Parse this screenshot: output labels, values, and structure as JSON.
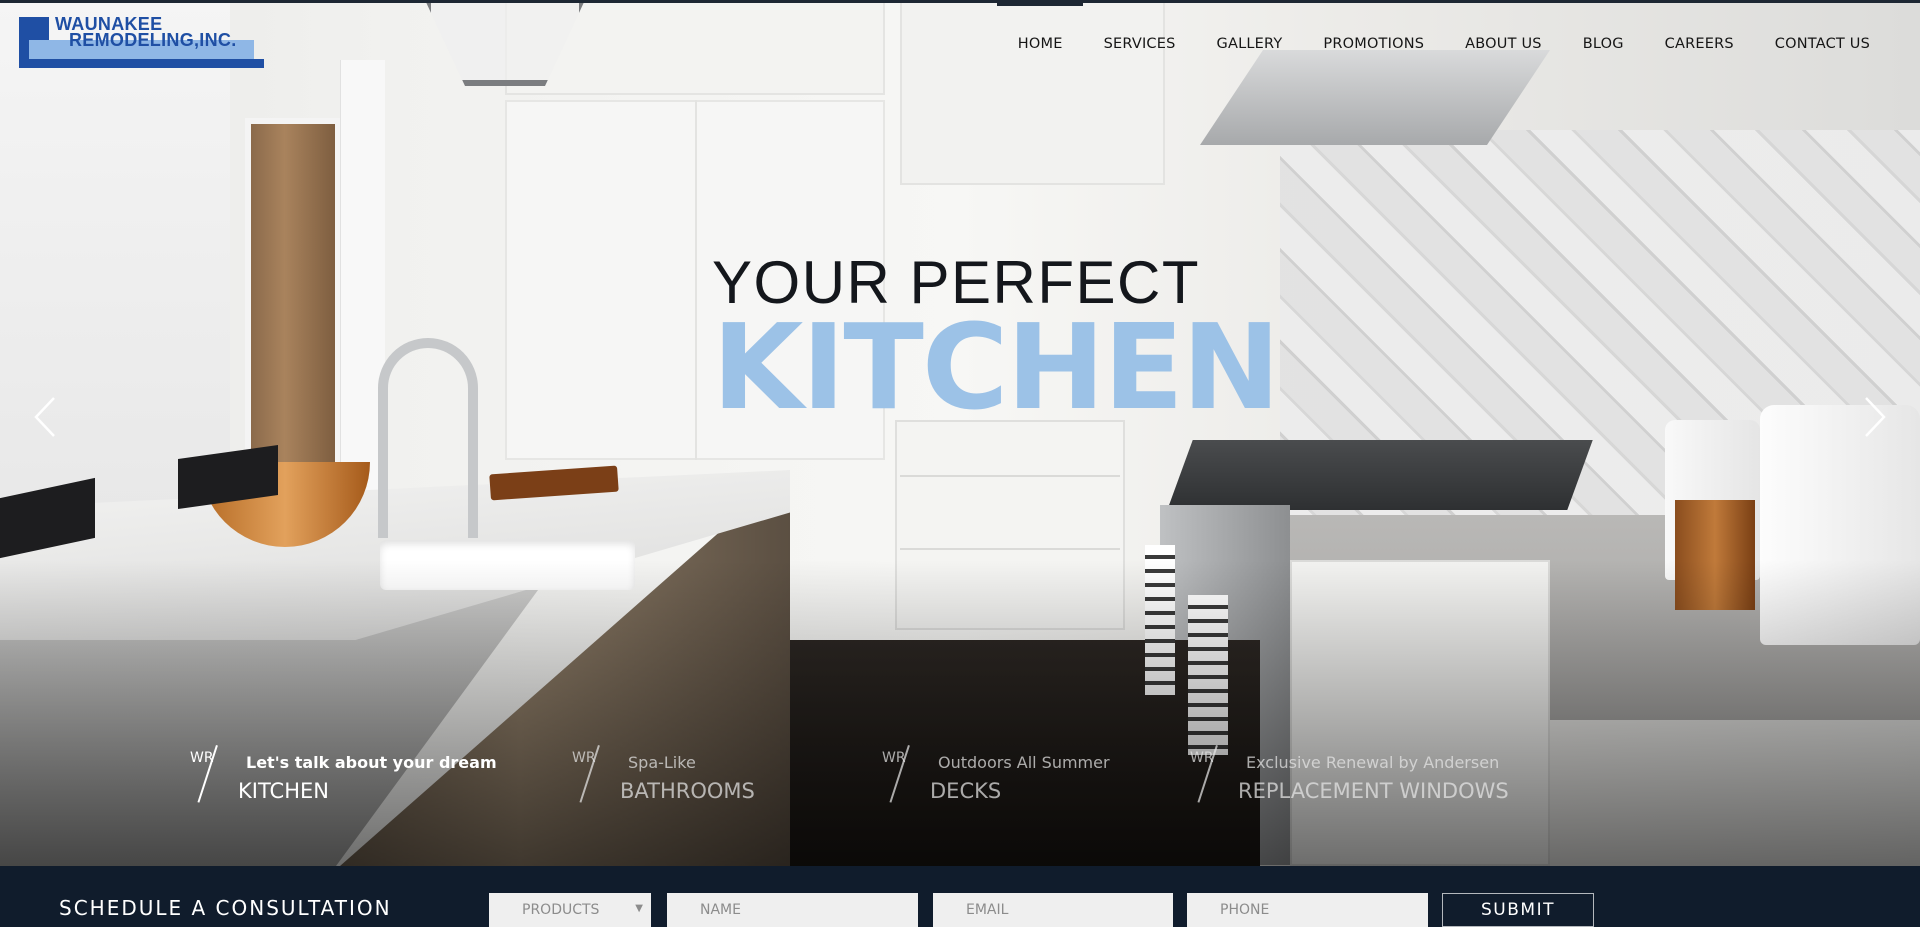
{
  "logo": {
    "line1": "WAUNAKEE",
    "line2": "REMODELING,INC."
  },
  "nav": {
    "items": [
      {
        "label": "HOME"
      },
      {
        "label": "SERVICES"
      },
      {
        "label": "GALLERY"
      },
      {
        "label": "PROMOTIONS"
      },
      {
        "label": "ABOUT US"
      },
      {
        "label": "BLOG"
      },
      {
        "label": "CAREERS"
      },
      {
        "label": "CONTACT US"
      }
    ],
    "active": "HOME"
  },
  "hero": {
    "line1": "YOUR PERFECT",
    "line2": "KITCHEN",
    "line2_color": "#9cc2e7",
    "prev_icon": "chevron-left-icon",
    "next_icon": "chevron-right-icon"
  },
  "slides": [
    {
      "wr": "WR",
      "sub": "Let's talk about your dream",
      "main": "KITCHEN",
      "active": true
    },
    {
      "wr": "WR",
      "sub": "Spa-Like",
      "main": "BATHROOMS",
      "active": false
    },
    {
      "wr": "WR",
      "sub": "Outdoors All Summer",
      "main": "DECKS",
      "active": false
    },
    {
      "wr": "WR",
      "sub": "Exclusive Renewal by Andersen",
      "main": "REPLACEMENT WINDOWS",
      "active": false
    }
  ],
  "consultation": {
    "title": "SCHEDULE A CONSULTATION",
    "products_selected": "PRODUCTS",
    "name_placeholder": "NAME",
    "email_placeholder": "EMAIL",
    "phone_placeholder": "PHONE",
    "submit_label": "SUBMIT"
  },
  "colors": {
    "brand_blue": "#1f4fa4",
    "brand_light_blue": "#8fb7e6",
    "footer_bar": "#101c2c"
  }
}
